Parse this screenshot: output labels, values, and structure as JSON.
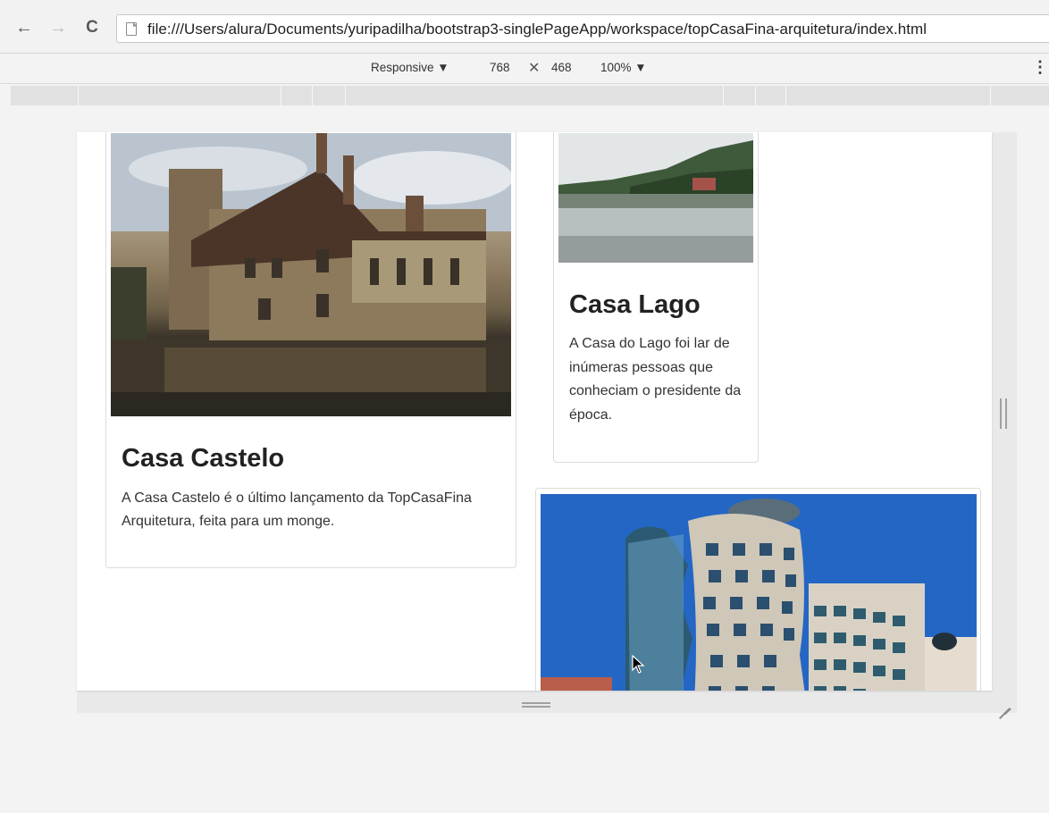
{
  "browser": {
    "back_glyph": "←",
    "forward_glyph": "→",
    "reload_glyph": "C",
    "url": "file:///Users/alura/Documents/yuripadilha/bootstrap3-singlePageApp/workspace/topCasaFina-arquitetura/index.html"
  },
  "device_toolbar": {
    "mode": "Responsive ▼",
    "width": "768",
    "times": "✕",
    "height": "468",
    "zoom": "100% ▼",
    "more": "⋮"
  },
  "cards": [
    {
      "title": "Casa Castelo",
      "text": "A Casa Castelo é o último lançamento da TopCasaFina Arquitetura, feita para um monge.",
      "image_subject": "stone-castle-with-moat"
    },
    {
      "title": "Casa Lago",
      "text": "A Casa do Lago foi lar de inúmeras pessoas que conheciam o presidente da época.",
      "image_subject": "lake-house"
    },
    {
      "title": "",
      "text": "",
      "image_subject": "dancing-house-building"
    }
  ],
  "colors": {
    "viewport_bg": "#ffffff",
    "card_border": "#dcdcdc",
    "text": "#333333"
  }
}
